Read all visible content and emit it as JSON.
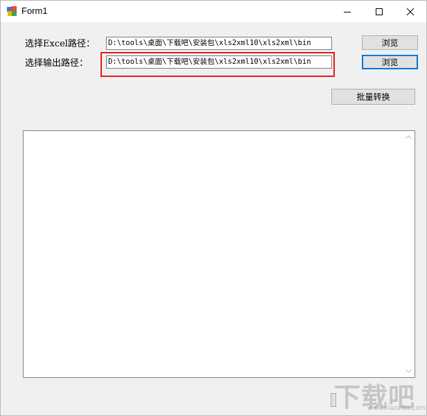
{
  "window": {
    "title": "Form1",
    "icon": "winforms-app-icon"
  },
  "form": {
    "excel_path_label": "选择Excel路径：",
    "excel_path_value": "D:\\tools\\桌面\\下载吧\\安装包\\xls2xml10\\xls2xml\\bin",
    "output_path_label": "选择输出路径：",
    "output_path_value": "D:\\tools\\桌面\\下载吧\\安装包\\xls2xml10\\xls2xml\\bin",
    "browse_excel_label": "浏览",
    "browse_output_label": "浏览",
    "batch_convert_label": "批量转换",
    "log_text": ""
  },
  "watermark": {
    "text": "下载吧",
    "url": "www.xiazaiba.com"
  },
  "colors": {
    "highlight": "#e01b1b",
    "focus": "#0078d7"
  }
}
